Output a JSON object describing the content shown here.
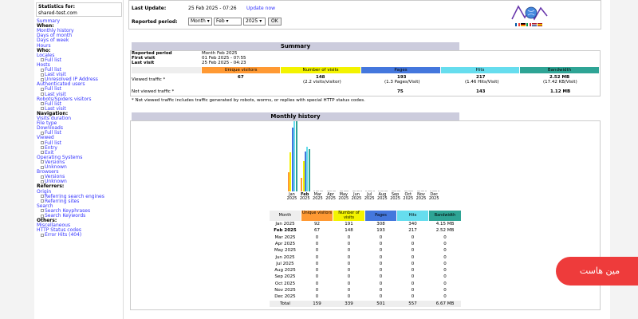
{
  "sidebar": {
    "stats_for_label": "Statistics for:",
    "site": "shared-test.com",
    "items": [
      {
        "label": "Summary",
        "type": "link"
      },
      {
        "label": "When:",
        "type": "group"
      },
      {
        "label": "Monthly history",
        "type": "link"
      },
      {
        "label": "Days of month",
        "type": "link"
      },
      {
        "label": "Days of week",
        "type": "link"
      },
      {
        "label": "Hours",
        "type": "link"
      },
      {
        "label": "Who:",
        "type": "group"
      },
      {
        "label": "Locales",
        "type": "link"
      },
      {
        "label": "Full list",
        "type": "sub"
      },
      {
        "label": "Hosts",
        "type": "link"
      },
      {
        "label": "Full list",
        "type": "sub"
      },
      {
        "label": "Last visit",
        "type": "sub"
      },
      {
        "label": "Unresolved IP Address",
        "type": "sub"
      },
      {
        "label": "Authenticated users",
        "type": "link"
      },
      {
        "label": "Full list",
        "type": "sub"
      },
      {
        "label": "Last visit",
        "type": "sub"
      },
      {
        "label": "Robots/Spiders visitors",
        "type": "link"
      },
      {
        "label": "Full list",
        "type": "sub"
      },
      {
        "label": "Last visit",
        "type": "sub"
      },
      {
        "label": "Navigation:",
        "type": "group"
      },
      {
        "label": "Visits duration",
        "type": "link"
      },
      {
        "label": "File type",
        "type": "link"
      },
      {
        "label": "Downloads",
        "type": "link"
      },
      {
        "label": "Full list",
        "type": "sub"
      },
      {
        "label": "Viewed",
        "type": "link"
      },
      {
        "label": "Full list",
        "type": "sub"
      },
      {
        "label": "Entry",
        "type": "sub"
      },
      {
        "label": "Exit",
        "type": "sub"
      },
      {
        "label": "Operating Systems",
        "type": "link"
      },
      {
        "label": "Versions",
        "type": "sub"
      },
      {
        "label": "Unknown",
        "type": "sub"
      },
      {
        "label": "Browsers",
        "type": "link"
      },
      {
        "label": "Versions",
        "type": "sub"
      },
      {
        "label": "Unknown",
        "type": "sub"
      },
      {
        "label": "Referrers:",
        "type": "group"
      },
      {
        "label": "Origin",
        "type": "link"
      },
      {
        "label": "Referring search engines",
        "type": "sub"
      },
      {
        "label": "Referring sites",
        "type": "sub"
      },
      {
        "label": "Search",
        "type": "link"
      },
      {
        "label": "Search Keyphrases",
        "type": "sub"
      },
      {
        "label": "Search Keywords",
        "type": "sub"
      },
      {
        "label": "Others:",
        "type": "group"
      },
      {
        "label": "Miscellaneous",
        "type": "link"
      },
      {
        "label": "HTTP Status codes",
        "type": "link"
      },
      {
        "label": "Error Hits (404)",
        "type": "sub"
      }
    ]
  },
  "header": {
    "last_update_label": "Last Update:",
    "last_update_value": "25 Feb 2025 - 07:26",
    "update_now": "Update now",
    "reported_period_label": "Reported period:",
    "period_type": "Month",
    "month": "Feb",
    "year": "2025",
    "ok": "OK"
  },
  "summary": {
    "title": "Summary",
    "reported_period_label": "Reported period",
    "reported_period_value": "Month Feb 2025",
    "first_visit_label": "First visit",
    "first_visit_value": "01 Feb 2025 - 07:55",
    "last_visit_label": "Last visit",
    "last_visit_value": "25 Feb 2025 - 04:23",
    "columns": [
      "Unique visitors",
      "Number of visits",
      "Pages",
      "Hits",
      "Bandwidth"
    ],
    "viewed_label": "Viewed traffic *",
    "viewed": [
      "67",
      "148",
      "193",
      "217",
      "2.52 MB"
    ],
    "viewed_sub": [
      "",
      "(2.2 visits/visitor)",
      "(1.3 Pages/Visit)",
      "(1.46 Hits/Visit)",
      "(17.42 KB/Visit)"
    ],
    "not_viewed_label": "Not viewed traffic *",
    "not_viewed": [
      "",
      "",
      "75",
      "143",
      "1.12 MB"
    ],
    "footnote": "* Not viewed traffic includes traffic generated by robots, worms, or replies with special HTTP status codes."
  },
  "history": {
    "title": "Monthly history",
    "months": [
      "Jan",
      "Feb",
      "Mar",
      "Apr",
      "May",
      "Jun",
      "Jul",
      "Aug",
      "Sep",
      "Oct",
      "Nov",
      "Dec"
    ],
    "year": "2025",
    "table_headers": [
      "Month",
      "Unique visitors",
      "Number of visits",
      "Pages",
      "Hits",
      "Bandwidth"
    ],
    "rows": [
      [
        "Jan 2025",
        "92",
        "191",
        "308",
        "340",
        "4.15 MB"
      ],
      [
        "Feb 2025",
        "67",
        "148",
        "193",
        "217",
        "2.52 MB"
      ],
      [
        "Mar 2025",
        "0",
        "0",
        "0",
        "0",
        "0"
      ],
      [
        "Apr 2025",
        "0",
        "0",
        "0",
        "0",
        "0"
      ],
      [
        "May 2025",
        "0",
        "0",
        "0",
        "0",
        "0"
      ],
      [
        "Jun 2025",
        "0",
        "0",
        "0",
        "0",
        "0"
      ],
      [
        "Jul 2025",
        "0",
        "0",
        "0",
        "0",
        "0"
      ],
      [
        "Aug 2025",
        "0",
        "0",
        "0",
        "0",
        "0"
      ],
      [
        "Sep 2025",
        "0",
        "0",
        "0",
        "0",
        "0"
      ],
      [
        "Oct 2025",
        "0",
        "0",
        "0",
        "0",
        "0"
      ],
      [
        "Nov 2025",
        "0",
        "0",
        "0",
        "0",
        "0"
      ],
      [
        "Dec 2025",
        "0",
        "0",
        "0",
        "0",
        "0"
      ]
    ],
    "total": [
      "Total",
      "159",
      "339",
      "501",
      "557",
      "6.67 MB"
    ]
  },
  "chart_data": {
    "type": "bar",
    "categories": [
      "Jan 2025",
      "Feb 2025",
      "Mar 2025",
      "Apr 2025",
      "May 2025",
      "Jun 2025",
      "Jul 2025",
      "Aug 2025",
      "Sep 2025",
      "Oct 2025",
      "Nov 2025",
      "Dec 2025"
    ],
    "series": [
      {
        "name": "Unique visitors",
        "values": [
          92,
          67,
          0,
          0,
          0,
          0,
          0,
          0,
          0,
          0,
          0,
          0
        ]
      },
      {
        "name": "Number of visits",
        "values": [
          191,
          148,
          0,
          0,
          0,
          0,
          0,
          0,
          0,
          0,
          0,
          0
        ]
      },
      {
        "name": "Pages",
        "values": [
          308,
          193,
          0,
          0,
          0,
          0,
          0,
          0,
          0,
          0,
          0,
          0
        ]
      },
      {
        "name": "Hits",
        "values": [
          340,
          217,
          0,
          0,
          0,
          0,
          0,
          0,
          0,
          0,
          0,
          0
        ]
      },
      {
        "name": "Bandwidth (MB)",
        "values": [
          4.15,
          2.52,
          0,
          0,
          0,
          0,
          0,
          0,
          0,
          0,
          0,
          0
        ]
      }
    ],
    "colors": {
      "uv": "#ff9933",
      "visits": "#f3f300",
      "pages": "#4477dd",
      "hits": "#66ddee",
      "bandwidth": "#2ea495"
    }
  },
  "watermark": {
    "text": "مین هاست"
  }
}
